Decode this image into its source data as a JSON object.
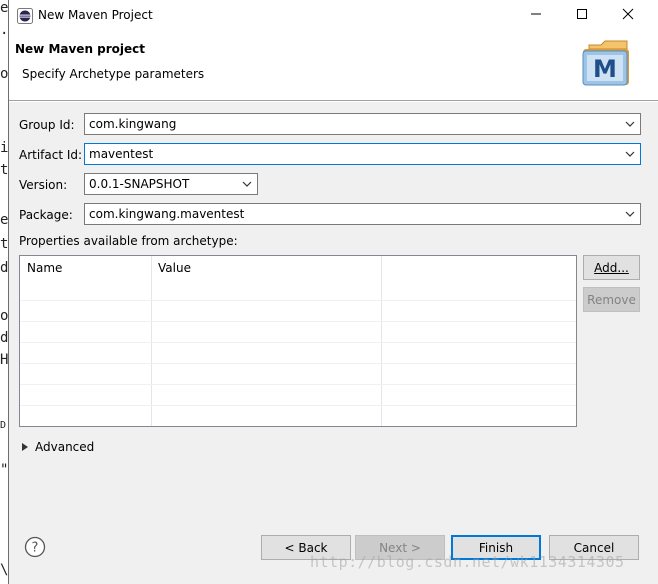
{
  "window": {
    "title": "New Maven Project",
    "minimize_glyph": "—",
    "maximize_glyph": "☐",
    "close_glyph": "✕"
  },
  "header": {
    "title": "New Maven project",
    "description": "Specify Archetype parameters",
    "logo_letter": "M"
  },
  "form": {
    "group_id_label": "Group Id:",
    "group_id_value": "com.kingwang",
    "artifact_id_label": "Artifact Id:",
    "artifact_id_value": "maventest",
    "version_label": "Version:",
    "version_value": "0.0.1-SNAPSHOT",
    "package_label": "Package:",
    "package_value": "com.kingwang.maventest"
  },
  "properties": {
    "section_label": "Properties available from archetype:",
    "columns": [
      "Name",
      "Value"
    ],
    "add_label": "Add...",
    "remove_label": "Remove"
  },
  "advanced": {
    "label": "Advanced",
    "toggle_glyph": "▶"
  },
  "footer": {
    "help_glyph": "?",
    "back_label": "< Back",
    "next_label": "Next >",
    "finish_label": "Finish",
    "cancel_label": "Cancel"
  },
  "watermark": "http://blog.csdn.net/wk1134314305",
  "background_fragments": [
    "e",
    ".",
    "o",
    "i",
    "t",
    "e",
    "t",
    "d",
    "o",
    "d",
    "H",
    "D",
    "\"",
    "\\"
  ],
  "colors": {
    "accent": "#0078d7",
    "dialog_bg": "#f0f0f0",
    "header_bg": "#ffffff"
  }
}
